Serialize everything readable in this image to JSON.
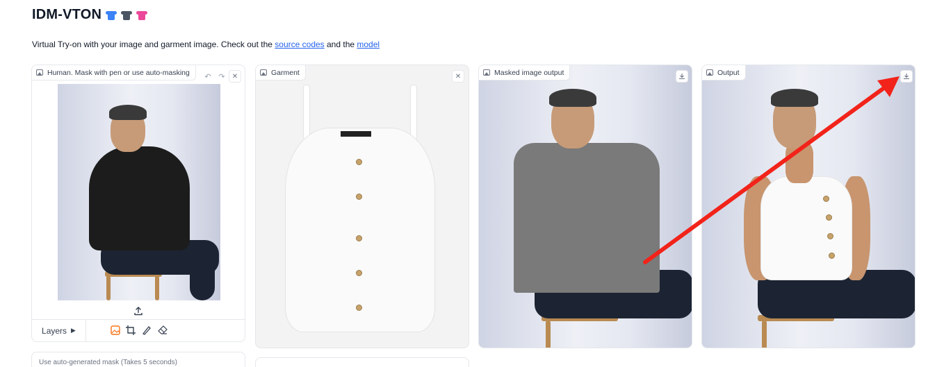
{
  "header": {
    "title": "IDM-VTON",
    "description_prefix": "Virtual Try-on with your image and garment image. Check out the ",
    "link_source": "source codes",
    "description_mid": " and the ",
    "link_model": "model"
  },
  "panels": {
    "human": {
      "label": "Human. Mask with pen or use auto-masking",
      "layers_label": "Layers"
    },
    "garment": {
      "label": "Garment"
    },
    "masked": {
      "label": "Masked image output"
    },
    "output": {
      "label": "Output"
    }
  },
  "options": {
    "auto_mask_label": "Use auto-generated mask (Takes 5 seconds)"
  },
  "icons": {
    "shirts": [
      "t-shirt-icon",
      "shirt-icon",
      "blouse-icon"
    ],
    "annotation": "red-arrow"
  },
  "colors": {
    "link": "#2563eb",
    "annotation": "#f2231a",
    "active_tool": "#f97316"
  }
}
